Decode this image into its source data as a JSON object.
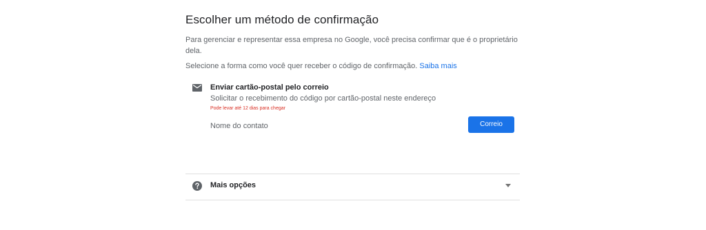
{
  "header": {
    "title": "Escolher um método de confirmação"
  },
  "intro": {
    "text": "Para gerenciar e representar essa empresa no Google, você precisa confirmar que é o proprietário dela."
  },
  "prompt": {
    "text": "Selecione a forma como você quer receber o código de confirmação.",
    "learn_more": "Saiba mais"
  },
  "method": {
    "icon": "mail-icon",
    "title": "Enviar cartão-postal pelo correio",
    "description": "Solicitar o recebimento do código por cartão-postal neste endereço",
    "note": "Pode levar até 12 dias para chegar",
    "contact_label": "Nome do contato",
    "button_label": "Correio"
  },
  "more_options": {
    "icon": "help-icon",
    "label": "Mais opções",
    "chevron_icon": "chevron-down-icon"
  },
  "colors": {
    "accent": "#1a73e8",
    "warning": "#d93025",
    "text_primary": "#202124",
    "text_secondary": "#5f6368",
    "divider": "#e0e0e0"
  }
}
